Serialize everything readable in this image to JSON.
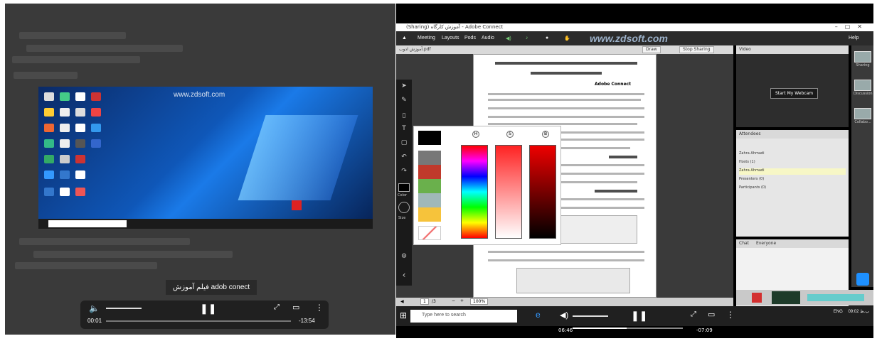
{
  "left_player": {
    "watermark": "www.zdsoft.com",
    "video_title": "فیلم آموزش adob conect",
    "elapsed": "00:01",
    "remaining": "-13:54",
    "volume_icon": "volume-icon",
    "pause_icon": "pause-icon",
    "progress_fraction": 0.0
  },
  "right_app": {
    "window_title": "(Sharing) آموزش کارگاه - Adobe Connect",
    "menu": [
      "Meeting",
      "Layouts",
      "Pods",
      "Audio"
    ],
    "help": "Help",
    "watermark": "www.zdsoft.com",
    "share_pod_title": "آموزش ادوب.pdf",
    "share_buttons": [
      "Draw",
      "Stop Sharing"
    ],
    "doc_heading": "Adobe Connect",
    "webcam_button": "Start My Webcam",
    "video_pod_title": "Video",
    "attendees_title": "Attendees",
    "attendees": [
      "Zahra Ahmadi",
      "Hosts (1)",
      "Zahra Ahmadi",
      "Presenters (0)",
      "Participants (0)"
    ],
    "chat_title": "Chat",
    "chat_subtitle": "Everyone",
    "layouts": [
      "Sharing",
      "Discussion",
      "Collabo..."
    ],
    "page_indicator": "1",
    "page_total": "/3",
    "zoom": "100%",
    "colors_label": "Color",
    "size_label": "Size"
  },
  "taskbar": {
    "search_placeholder": "Type here to search",
    "time": "06:46",
    "remaining": "-07:09",
    "tray_lang": "ENG",
    "tray_time": "09:02 ب.ظ",
    "progress_fraction": 0.49
  },
  "colors": {
    "accent_blue": "#1e90ff",
    "player_bg": "#202020",
    "red": "#d32f2f"
  }
}
